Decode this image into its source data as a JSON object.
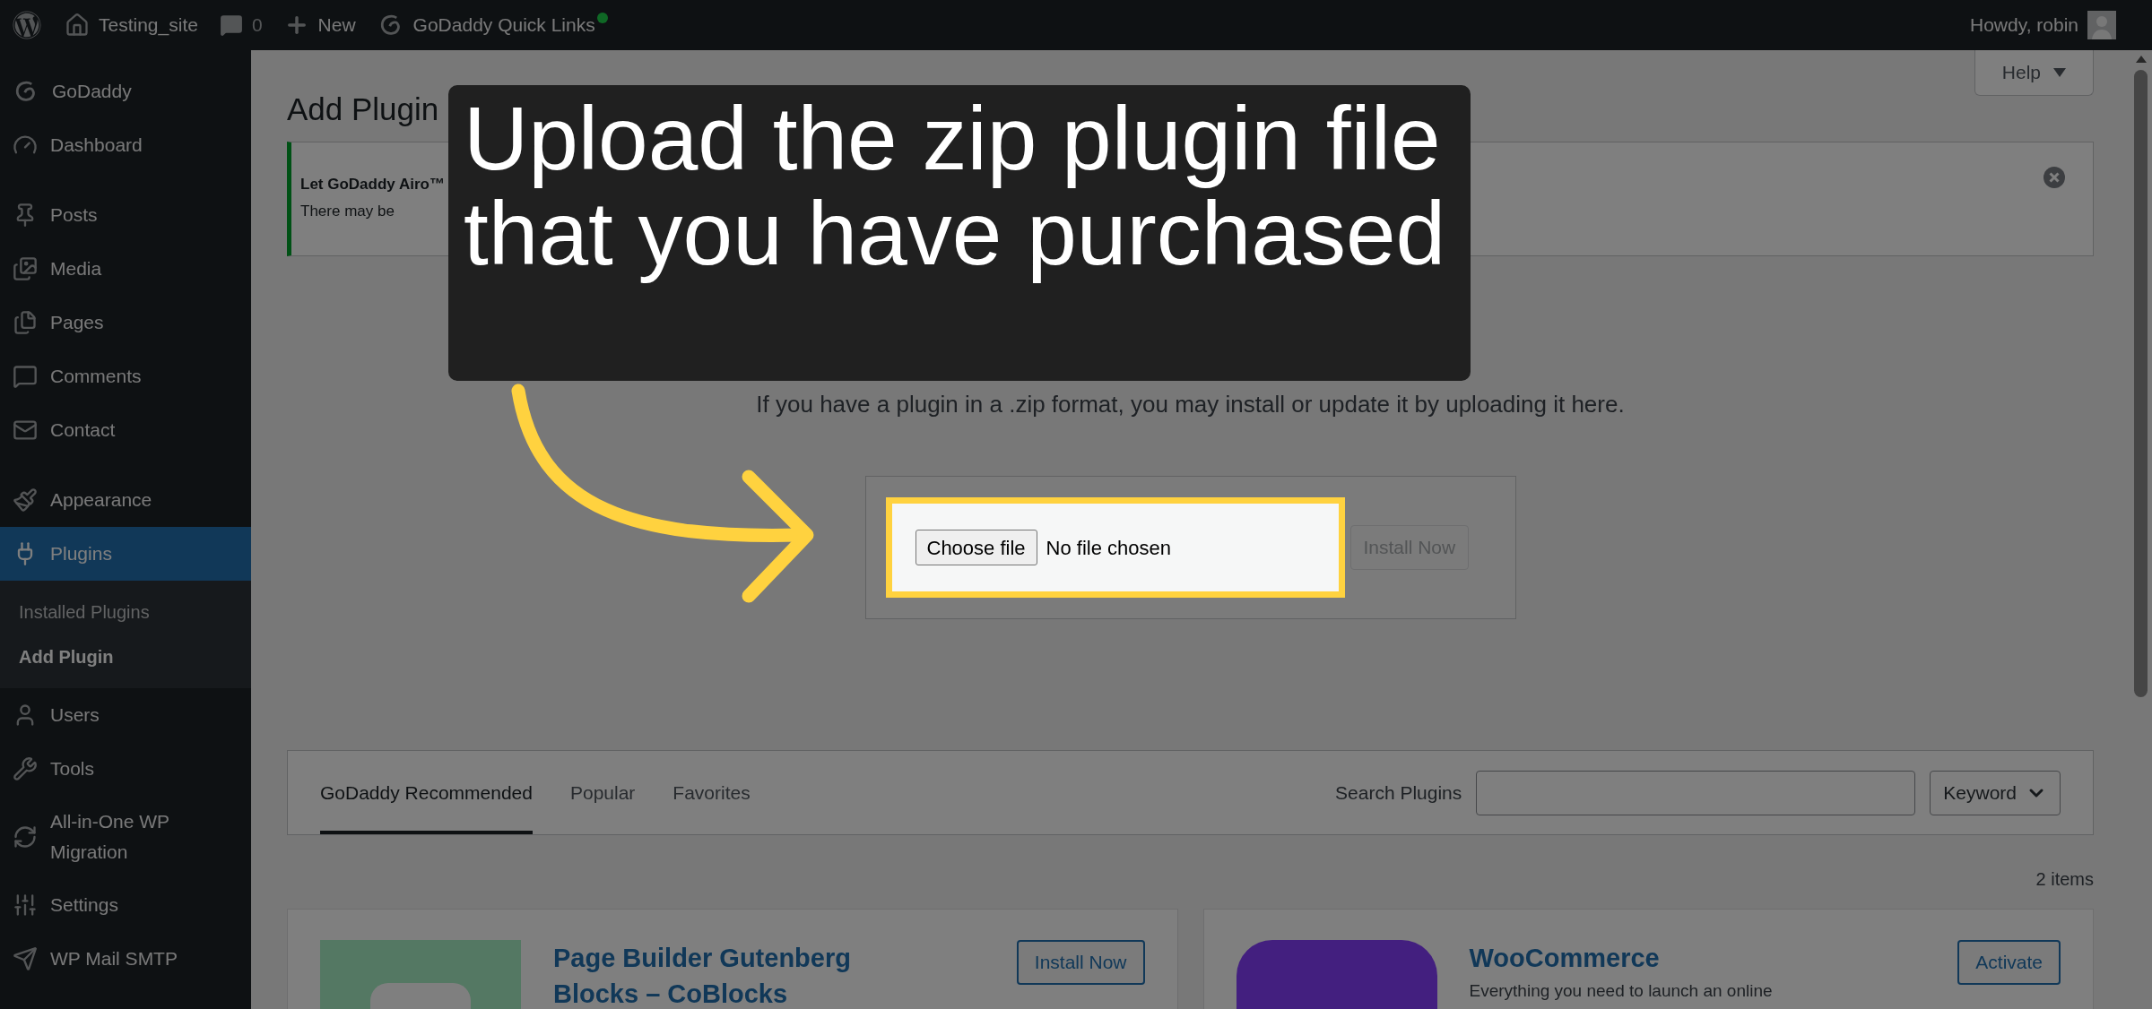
{
  "admin_bar": {
    "items": [
      {
        "kind": "wp"
      },
      {
        "kind": "site",
        "label": "Testing_site"
      },
      {
        "kind": "comments",
        "label": "0"
      },
      {
        "kind": "new",
        "label": "New"
      },
      {
        "kind": "godaddy",
        "label": "GoDaddy Quick Links"
      }
    ],
    "greeting": "Howdy, robin"
  },
  "sidebar": {
    "groups": [
      {
        "items": [
          {
            "kind": "godaddy",
            "label": "GoDaddy",
            "selected": false
          },
          {
            "kind": "dashboard",
            "label": "Dashboard",
            "selected": false
          }
        ]
      },
      {
        "items": [
          {
            "kind": "posts",
            "label": "Posts",
            "selected": false
          },
          {
            "kind": "media",
            "label": "Media",
            "selected": false
          },
          {
            "kind": "pages",
            "label": "Pages",
            "selected": false
          },
          {
            "kind": "comments",
            "label": "Comments",
            "selected": false
          },
          {
            "kind": "contact",
            "label": "Contact",
            "selected": false
          }
        ]
      },
      {
        "items": [
          {
            "kind": "appearance",
            "label": "Appearance",
            "selected": false
          },
          {
            "kind": "plugins",
            "label": "Plugins",
            "selected": true,
            "children": [
              {
                "label": "Installed Plugins",
                "selected": false
              },
              {
                "label": "Add Plugin",
                "selected": true
              }
            ]
          },
          {
            "kind": "users",
            "label": "Users",
            "selected": false
          },
          {
            "kind": "tools",
            "label": "Tools",
            "selected": false
          },
          {
            "kind": "migration",
            "label": "All-in-One WP Migration",
            "selected": false
          },
          {
            "kind": "settings",
            "label": "Settings",
            "selected": false
          },
          {
            "kind": "smtp",
            "label": "WP Mail SMTP",
            "selected": false
          }
        ]
      }
    ]
  },
  "page": {
    "title": "Add Plugin",
    "help": "Help"
  },
  "notice": {
    "title": "Let GoDaddy Airo™",
    "text": "There may be"
  },
  "upload": {
    "description": "If you have a plugin in a .zip format, you may install or update it by uploading it here.",
    "file_button": "Choose file",
    "file_status": "No file chosen",
    "install_button": "Install Now",
    "install_disabled": true
  },
  "callout": {
    "text": "Upload the zip plugin file that you have purchased"
  },
  "tabs": [
    {
      "label": "GoDaddy Recommended",
      "selected": true
    },
    {
      "label": "Popular",
      "selected": false
    },
    {
      "label": "Favorites",
      "selected": false
    }
  ],
  "search": {
    "label": "Search Plugins",
    "type": "Keyword"
  },
  "count": "2 items",
  "plugins": [
    {
      "kind": "coblocks",
      "name": "Page Builder Gutenberg Blocks – CoBlocks",
      "action": "Install Now"
    },
    {
      "kind": "woo",
      "name": "WooCommerce",
      "action": "Activate",
      "description": "Everything you need to launch an online"
    }
  ]
}
